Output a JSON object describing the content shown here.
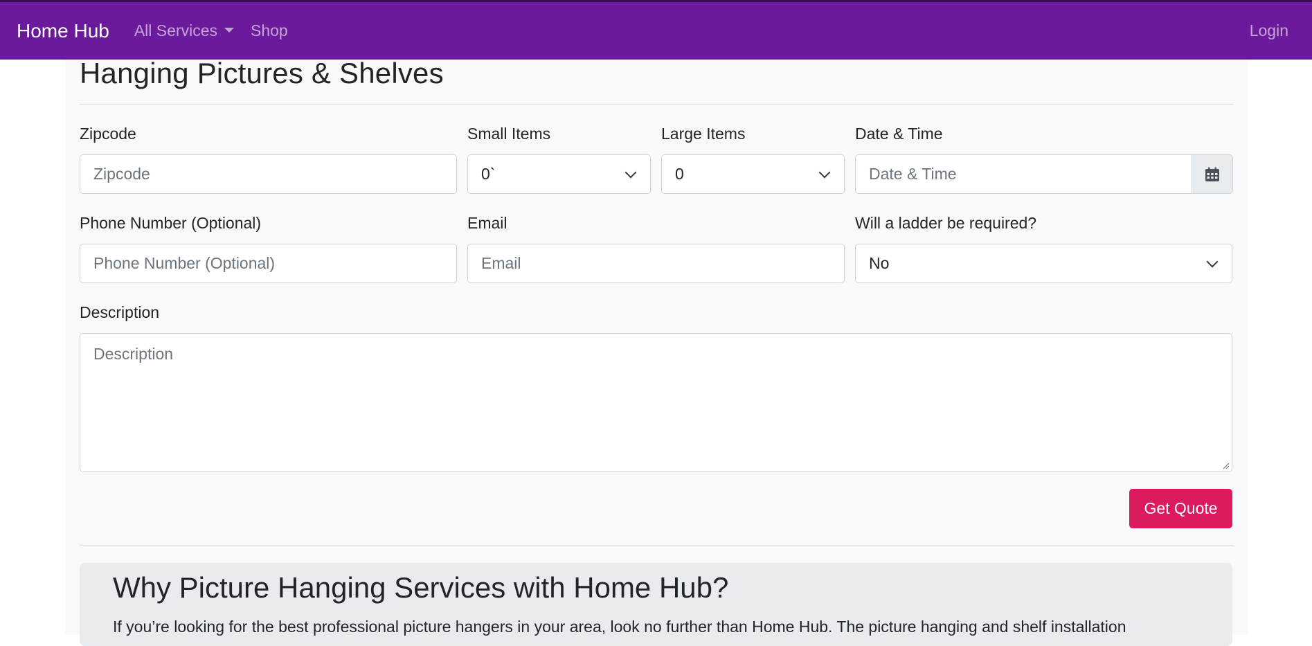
{
  "navbar": {
    "brand": "Home Hub",
    "all_services": "All Services",
    "shop": "Shop",
    "login": "Login"
  },
  "page": {
    "title": "Hanging Pictures & Shelves"
  },
  "form": {
    "zipcode": {
      "label": "Zipcode",
      "placeholder": "Zipcode"
    },
    "small_items": {
      "label": "Small Items",
      "value": "0`"
    },
    "large_items": {
      "label": "Large Items",
      "value": "0"
    },
    "date_time": {
      "label": "Date & Time",
      "placeholder": "Date & Time",
      "icon": "calendar-icon"
    },
    "phone": {
      "label": "Phone Number (Optional)",
      "placeholder": "Phone Number (Optional)"
    },
    "email": {
      "label": "Email",
      "placeholder": "Email"
    },
    "ladder": {
      "label": "Will a ladder be required?",
      "value": "No"
    },
    "description": {
      "label": "Description",
      "placeholder": "Description"
    },
    "submit_label": "Get Quote"
  },
  "info": {
    "heading": "Why Picture Hanging Services with Home Hub?",
    "text": "If you’re looking for the best professional picture hangers in your area, look no further than Home Hub. The picture hanging and shelf installation"
  },
  "colors": {
    "navbar": "#6c1a9c",
    "button": "#dc1b5e"
  }
}
